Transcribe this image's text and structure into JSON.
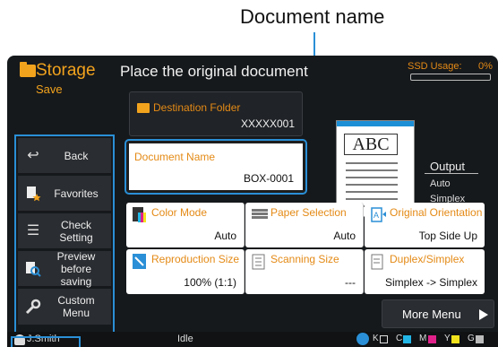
{
  "annotation": {
    "callout": "Document name"
  },
  "mode": {
    "name": "Storage",
    "sub": "Save"
  },
  "headline": "Place the original document",
  "ssd": {
    "label": "SSD Usage:",
    "value": "0%"
  },
  "side_menu": [
    {
      "label": "Back",
      "icon": "back-arrow-icon"
    },
    {
      "label": "Favorites",
      "icon": "favorites-icon"
    },
    {
      "label": "Check Setting",
      "icon": "list-icon"
    },
    {
      "label": "Preview before saving",
      "icon": "preview-icon"
    },
    {
      "label": "Custom Menu",
      "icon": "wrench-icon"
    }
  ],
  "destination": {
    "label": "Destination Folder",
    "value": "XXXXX001"
  },
  "document_name": {
    "label": "Document Name",
    "value": "BOX-0001"
  },
  "settings": [
    {
      "label": "Color Mode",
      "value": "Auto",
      "icon": "color-mode-icon"
    },
    {
      "label": "Paper Selection",
      "value": "Auto",
      "icon": "paper-selection-icon"
    },
    {
      "label": "Original Orientation",
      "value": "Top Side Up",
      "icon": "orientation-icon"
    },
    {
      "label": "Reproduction Size",
      "value": "100% (1:1)",
      "icon": "reproduction-size-icon"
    },
    {
      "label": "Scanning Size",
      "value": "---",
      "icon": "scanning-size-icon"
    },
    {
      "label": "Duplex/Simplex",
      "value": "Simplex -> Simplex",
      "icon": "duplex-icon"
    }
  ],
  "preview": {
    "text": "ABC"
  },
  "output": {
    "title": "Output",
    "line1": "Auto",
    "line2": "Simplex"
  },
  "more_menu": {
    "label": "More Menu"
  },
  "status": {
    "user": "J.Smith",
    "state": "Idle",
    "inks": [
      {
        "letter": "K",
        "color": "#ffffff"
      },
      {
        "letter": "C",
        "color": "#22b6e6"
      },
      {
        "letter": "M",
        "color": "#e0218a"
      },
      {
        "letter": "Y",
        "color": "#f2e21d"
      },
      {
        "letter": "G",
        "color": "#bbbbbb"
      }
    ]
  },
  "colors": {
    "accent": "#f2a31d",
    "highlight": "#2a8fd6",
    "screen_bg": "#16191c"
  }
}
